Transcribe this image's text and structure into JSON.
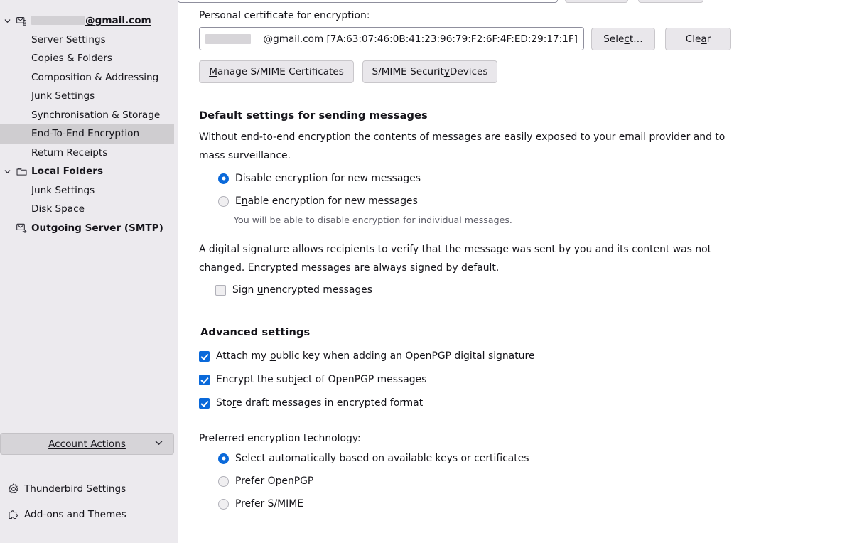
{
  "sidebar": {
    "account": {
      "label_suffix": "@gmail.com",
      "redacted": true,
      "icon": "envelope-lock-icon"
    },
    "account_children": [
      {
        "label": "Server Settings",
        "selected": false
      },
      {
        "label": "Copies & Folders",
        "selected": false
      },
      {
        "label": "Composition & Addressing",
        "selected": false
      },
      {
        "label": "Junk Settings",
        "selected": false
      },
      {
        "label": "Synchronisation & Storage",
        "selected": false
      },
      {
        "label": "End-To-End Encryption",
        "selected": true
      },
      {
        "label": "Return Receipts",
        "selected": false
      }
    ],
    "local_folders": {
      "label": "Local Folders",
      "icon": "folder-icon",
      "children": [
        {
          "label": "Junk Settings"
        },
        {
          "label": "Disk Space"
        }
      ]
    },
    "outgoing_server": {
      "label": "Outgoing Server (SMTP)",
      "icon": "outgoing-server-icon"
    },
    "account_actions": {
      "label": "Account Actions",
      "accesskey": "A",
      "chevron": "chevron-down-icon"
    },
    "footer": [
      {
        "label": "Thunderbird Settings",
        "icon": "gear-icon"
      },
      {
        "label": "Add-ons and Themes",
        "icon": "puzzle-piece-icon"
      }
    ]
  },
  "main": {
    "encryption_cert": {
      "label": "Personal certificate for encryption:",
      "value_suffix": "@gmail.com [7A:63:07:46:0B:41:23:96:79:F2:6F:4F:ED:29:17:1F]",
      "redacted": true,
      "select_button": {
        "pre": "Sele",
        "key": "c",
        "post": "t…"
      },
      "clear_button": {
        "pre": "Cle",
        "key": "a",
        "post": "r"
      }
    },
    "smime_buttons": {
      "manage": {
        "pre": "",
        "key": "M",
        "post": "anage S/MIME Certificates"
      },
      "devices": {
        "pre": "S/MIME Securit",
        "key": "y",
        "post": " Devices"
      }
    },
    "default_settings": {
      "heading": "Default settings for sending messages",
      "paragraph": "Without end-to-end encryption the contents of messages are easily exposed to your email provider and to mass surveillance.",
      "options": [
        {
          "pre": "",
          "key": "D",
          "post": "isable encryption for new messages",
          "selected": true
        },
        {
          "pre": "E",
          "key": "n",
          "post": "able encryption for new messages",
          "selected": false
        }
      ],
      "hint": "You will be able to disable encryption for individual messages."
    },
    "signature": {
      "paragraph": "A digital signature allows recipients to verify that the message was sent by you and its content was not changed. Encrypted messages are always signed by default.",
      "checkbox": {
        "pre": "Sign ",
        "key": "u",
        "post": "nencrypted messages",
        "checked": false
      }
    },
    "advanced": {
      "heading": "Advanced settings",
      "checkboxes": [
        {
          "pre": "Attach my ",
          "key": "p",
          "post": "ublic key when adding an OpenPGP digital signature",
          "checked": true
        },
        {
          "pre": "Encrypt the sub",
          "key": "j",
          "post": "ect of OpenPGP messages",
          "checked": true
        },
        {
          "pre": "Sto",
          "key": "r",
          "post": "e draft messages in encrypted format",
          "checked": true
        }
      ]
    },
    "preferred": {
      "label": "Preferred encryption technology:",
      "options": [
        {
          "label": "Select automatically based on available keys or certificates",
          "selected": true
        },
        {
          "label": "Prefer OpenPGP",
          "selected": false
        },
        {
          "label": "Prefer S/MIME",
          "selected": false
        }
      ]
    }
  },
  "colors": {
    "accent": "#0a69da",
    "sidebar_bg": "#eceaee",
    "selection_bg": "#cfcdd0",
    "button_bg": "#e9e7eb"
  }
}
